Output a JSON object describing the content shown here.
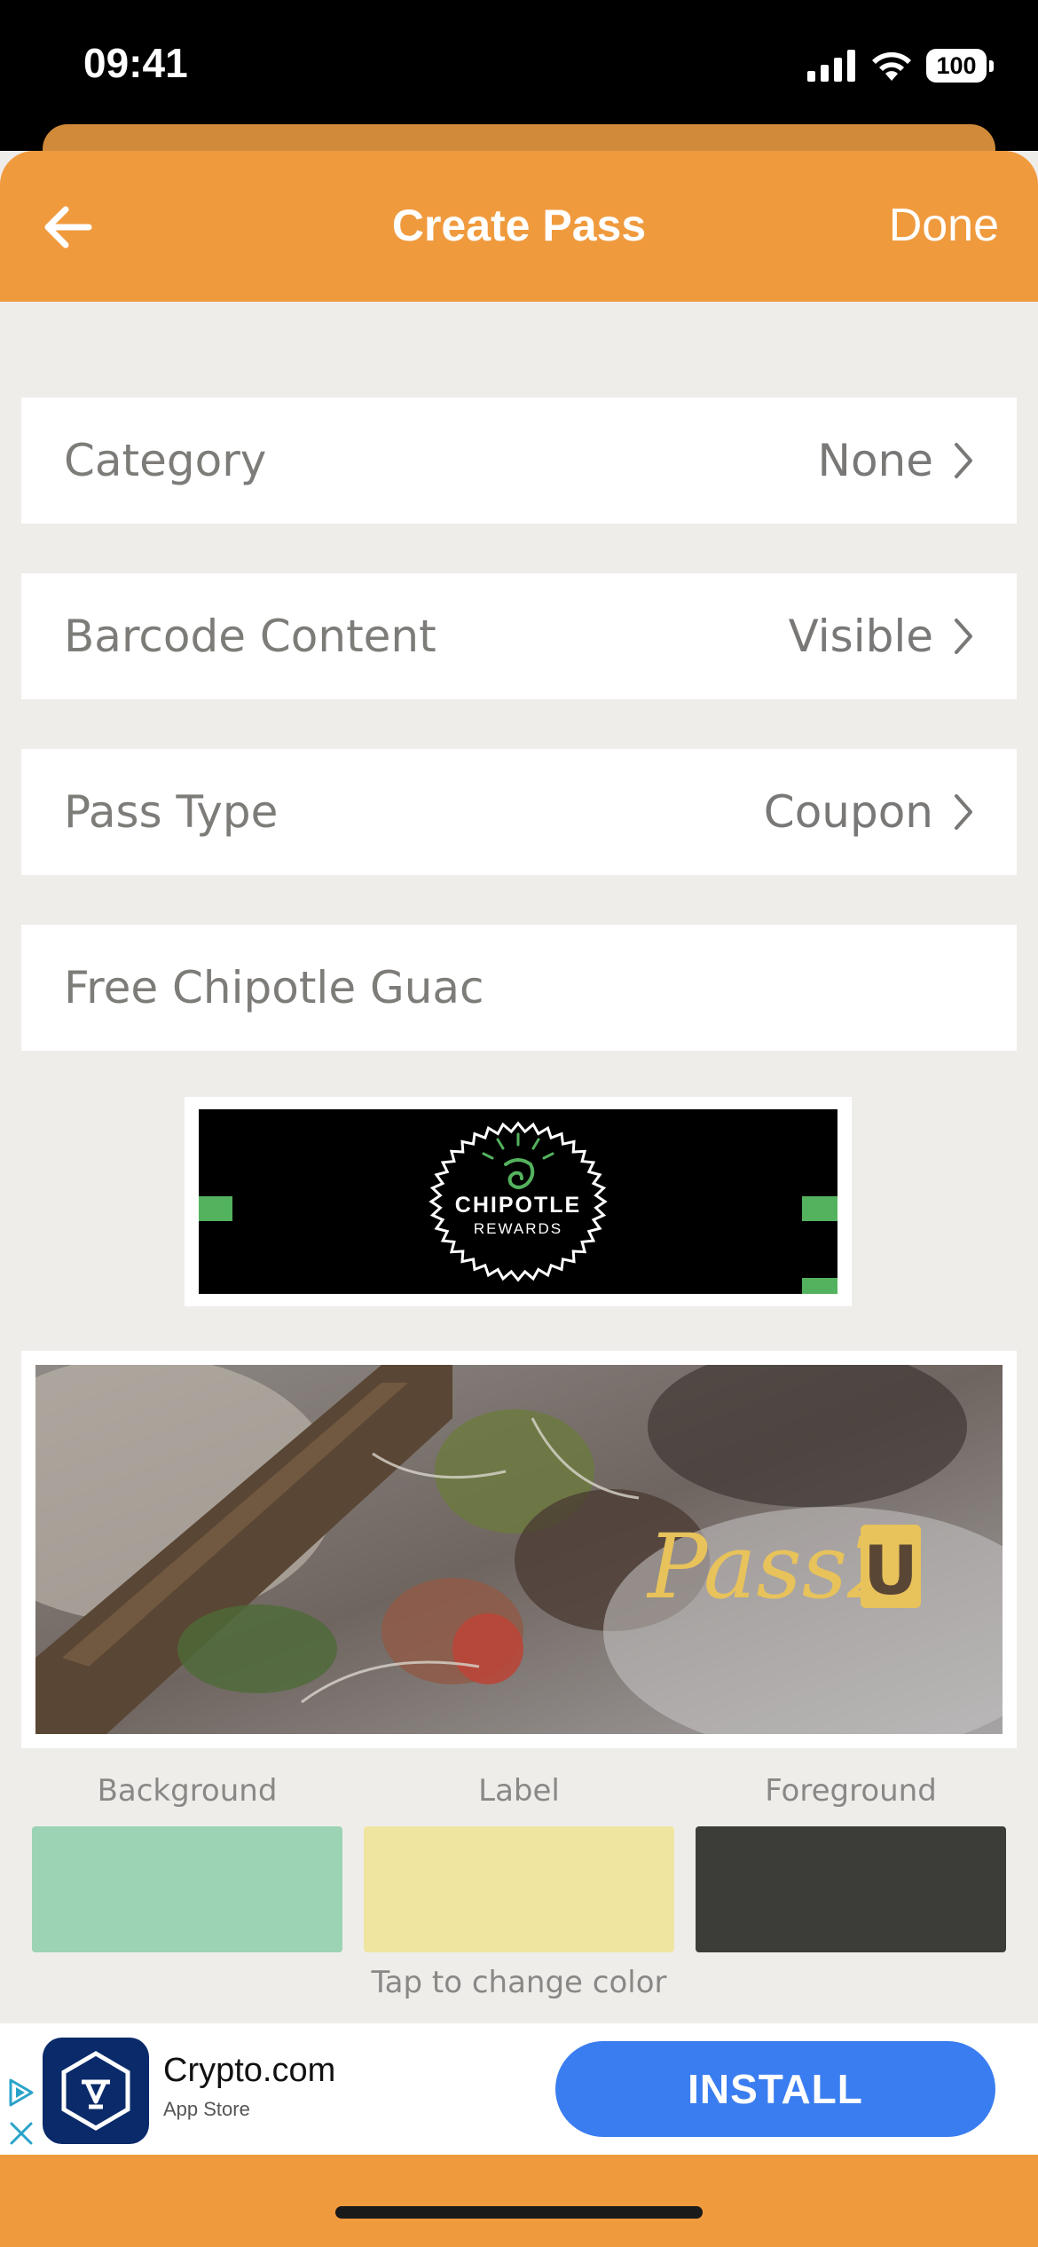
{
  "status": {
    "time": "09:41",
    "battery": "100"
  },
  "nav": {
    "title": "Create Pass",
    "done_label": "Done"
  },
  "rows": {
    "category": {
      "label": "Category",
      "value": "None"
    },
    "barcode": {
      "label": "Barcode Content",
      "value": "Visible"
    },
    "pass_type": {
      "label": "Pass Type",
      "value": "Coupon"
    },
    "pass_name": {
      "value": "Free Chipotle Guac"
    }
  },
  "logo": {
    "line1": "CHIPOTLE",
    "line2": "REWARDS"
  },
  "strip": {
    "watermark": "Pass2",
    "watermark_mark": "U"
  },
  "colors": {
    "labels": [
      "Background",
      "Label",
      "Foreground"
    ],
    "values": [
      "#9bd3b4",
      "#efe5a0",
      "#3c3d39"
    ],
    "hint": "Tap to change color"
  },
  "ad": {
    "app_name": "Crypto.com",
    "store": "App Store",
    "install_label": "INSTALL"
  }
}
